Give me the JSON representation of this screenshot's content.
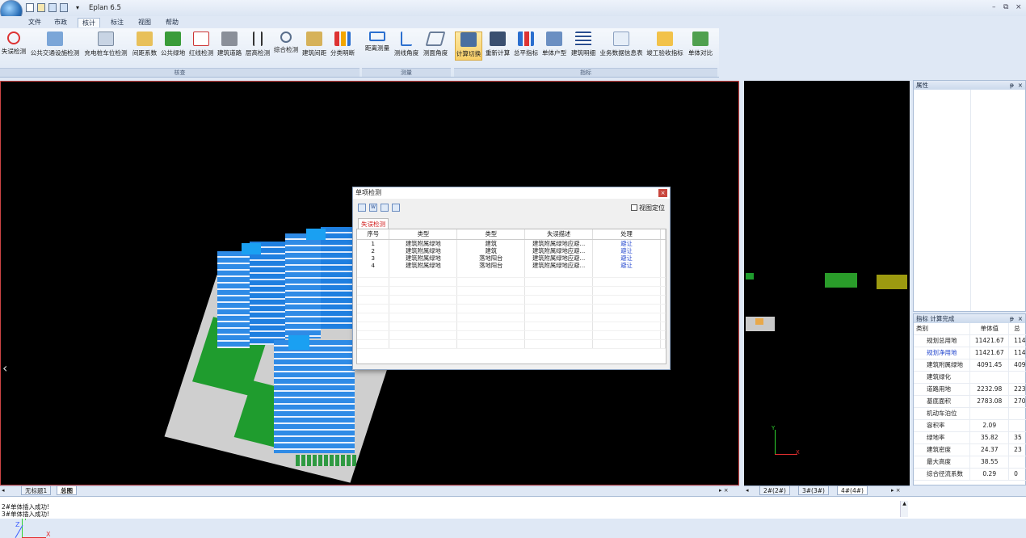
{
  "app": {
    "title": "Eplan 6.5",
    "min": "–",
    "restore": "⧉",
    "close": "×"
  },
  "menu": [
    "文件",
    "市政",
    "核计",
    "标注",
    "视图",
    "帮助"
  ],
  "ribbon": {
    "check_buttons": [
      "失误检测",
      "公共交通设施检测",
      "充电桩车位检测",
      "间距系数",
      "公共绿地",
      "红线检测",
      "建筑道路",
      "层高检测",
      "综合检测",
      "建筑间距",
      "分类明断"
    ],
    "check_group": "核查",
    "measure_buttons": [
      "距离测量",
      "测线角度",
      "测面角度"
    ],
    "measure_group": "测量",
    "index_buttons": [
      "计算切换",
      "重新计算",
      "总平指标",
      "单体户型",
      "建筑明细",
      "业务数据信息表",
      "竣工验收指标",
      "单体对比"
    ],
    "index_group": "指标"
  },
  "properties": {
    "title": "属性",
    "pin": "ᵽ",
    "close": "×"
  },
  "index_panel": {
    "title": "指标 计算完成",
    "headers": [
      "类别",
      "单体值",
      "总"
    ],
    "rows": [
      {
        "name": "规划总用地",
        "v1": "11421.67",
        "v2": "114",
        "link": false
      },
      {
        "name": "规划净用地",
        "v1": "11421.67",
        "v2": "114",
        "link": true
      },
      {
        "name": "建筑附属绿地",
        "v1": "4091.45",
        "v2": "409",
        "link": false
      },
      {
        "name": "建筑绿化",
        "v1": "",
        "v2": "",
        "link": false
      },
      {
        "name": "道路用地",
        "v1": "2232.98",
        "v2": "223",
        "link": false
      },
      {
        "name": "基底面积",
        "v1": "2783.08",
        "v2": "270",
        "link": false
      },
      {
        "name": "机动车泊位",
        "v1": "",
        "v2": "",
        "link": false
      },
      {
        "name": "容积率",
        "v1": "2.09",
        "v2": "",
        "link": false
      },
      {
        "name": "绿地率",
        "v1": "35.82",
        "v2": "35",
        "link": false
      },
      {
        "name": "建筑密度",
        "v1": "24.37",
        "v2": "23",
        "link": false
      },
      {
        "name": "最大高度",
        "v1": "38.55",
        "v2": "",
        "link": false
      },
      {
        "name": "综合径流系数",
        "v1": "0.29",
        "v2": "0",
        "link": false
      }
    ]
  },
  "dialog": {
    "title": "单项检测",
    "close": "×",
    "view_locate": "视图定位",
    "tab": "失误检测",
    "columns": [
      "序号",
      "类型",
      "类型",
      "失误描述",
      "处理"
    ],
    "rows": [
      {
        "no": "1",
        "t1": "建筑附属绿地",
        "t2": "建筑",
        "desc": "建筑附属绿地应避...",
        "act": "避让"
      },
      {
        "no": "2",
        "t1": "建筑附属绿地",
        "t2": "建筑",
        "desc": "建筑附属绿地应避...",
        "act": "避让"
      },
      {
        "no": "3",
        "t1": "建筑附属绿地",
        "t2": "落地阳台",
        "desc": "建筑附属绿地应避...",
        "act": "避让"
      },
      {
        "no": "4",
        "t1": "建筑附属绿地",
        "t2": "落地阳台",
        "desc": "建筑附属绿地应避...",
        "act": "避让"
      }
    ]
  },
  "bottom_tabs_left": [
    "无标题1",
    "总图"
  ],
  "bottom_tabs_right": [
    "2#(2#)",
    "3#(3#)",
    "4#(4#)"
  ],
  "status_lines": [
    "2#单体插入成功!",
    "3#单体插入成功!"
  ],
  "axes": {
    "y": "Y",
    "x": "X",
    "z": "Z"
  },
  "colors": {
    "accent": "#f8cf67",
    "link": "#1a3fcc",
    "alert": "#d22020"
  }
}
